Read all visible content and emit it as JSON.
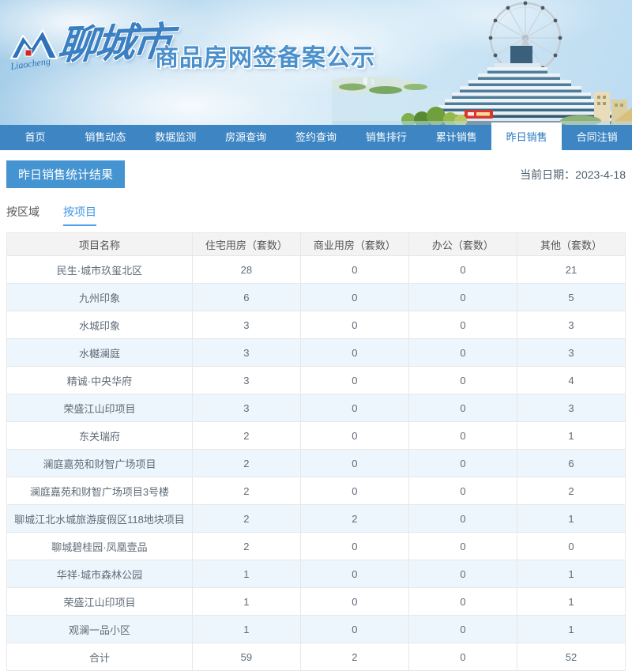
{
  "banner": {
    "logo_script": "Liaocheng",
    "brand_city": "聊城市",
    "brand_subtitle": "商品房网签备案公示"
  },
  "nav": {
    "items": [
      {
        "label": "首页",
        "active": false
      },
      {
        "label": "销售动态",
        "active": false
      },
      {
        "label": "数据监测",
        "active": false
      },
      {
        "label": "房源查询",
        "active": false
      },
      {
        "label": "签约查询",
        "active": false
      },
      {
        "label": "销售排行",
        "active": false
      },
      {
        "label": "累计销售",
        "active": false
      },
      {
        "label": "昨日销售",
        "active": true
      },
      {
        "label": "合同注销",
        "active": false
      }
    ]
  },
  "page": {
    "section_title": "昨日销售统计结果",
    "current_date": "当前日期：2023-4-18"
  },
  "tabs": [
    {
      "label": "按区域",
      "active": false
    },
    {
      "label": "按项目",
      "active": true
    }
  ],
  "table": {
    "columns": [
      "项目名称",
      "住宅用房（套数）",
      "商业用房（套数）",
      "办公（套数）",
      "其他（套数）"
    ],
    "rows": [
      [
        "民生·城市玖玺北区",
        "28",
        "0",
        "0",
        "21"
      ],
      [
        "九州印象",
        "6",
        "0",
        "0",
        "5"
      ],
      [
        "水城印象",
        "3",
        "0",
        "0",
        "3"
      ],
      [
        "水樾澜庭",
        "3",
        "0",
        "0",
        "3"
      ],
      [
        "精诚·中央华府",
        "3",
        "0",
        "0",
        "4"
      ],
      [
        "荣盛江山印项目",
        "3",
        "0",
        "0",
        "3"
      ],
      [
        "东关瑞府",
        "2",
        "0",
        "0",
        "1"
      ],
      [
        "澜庭嘉苑和财智广场项目",
        "2",
        "0",
        "0",
        "6"
      ],
      [
        "澜庭嘉苑和财智广场项目3号楼",
        "2",
        "0",
        "0",
        "2"
      ],
      [
        "聊城江北水城旅游度假区118地块项目",
        "2",
        "2",
        "0",
        "1"
      ],
      [
        "聊城碧桂园·凤凰壹品",
        "2",
        "0",
        "0",
        "0"
      ],
      [
        "华祥·城市森林公园",
        "1",
        "0",
        "0",
        "1"
      ],
      [
        "荣盛江山印项目",
        "1",
        "0",
        "0",
        "1"
      ],
      [
        "观澜一品小区",
        "1",
        "0",
        "0",
        "1"
      ]
    ],
    "total_row": [
      "合计",
      "59",
      "2",
      "0",
      "52"
    ]
  },
  "colors": {
    "nav_blue": "#3d85c3",
    "nav_active_text": "#2778c0",
    "section_title_bg": "#4594d2",
    "tab_active": "#3f97e2",
    "tab_underline": "#4da2ea",
    "table_header_bg": "#f3f3f3",
    "row_stripe_bg": "#eef6fd",
    "table_border": "#e7e7e7",
    "brand_blue": "#4a90cc",
    "logo_red": "#d02622"
  }
}
